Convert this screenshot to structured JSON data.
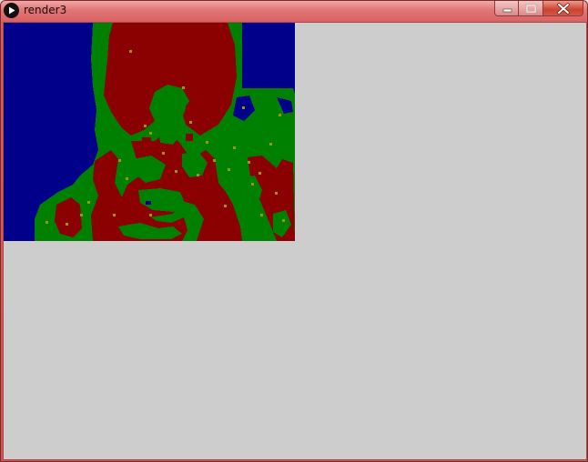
{
  "window": {
    "title": "render3",
    "minimize_icon": "minimize-icon",
    "maximize_icon": "maximize-icon",
    "close_icon": "close-icon",
    "app_icon": "play-icon"
  },
  "canvas": {
    "description_colors": {
      "background": "#00008b",
      "figure": "#8b0000",
      "edge": "#008000",
      "highlight": "#9a9a00"
    }
  },
  "client": {
    "background": "#cdcdcd"
  }
}
